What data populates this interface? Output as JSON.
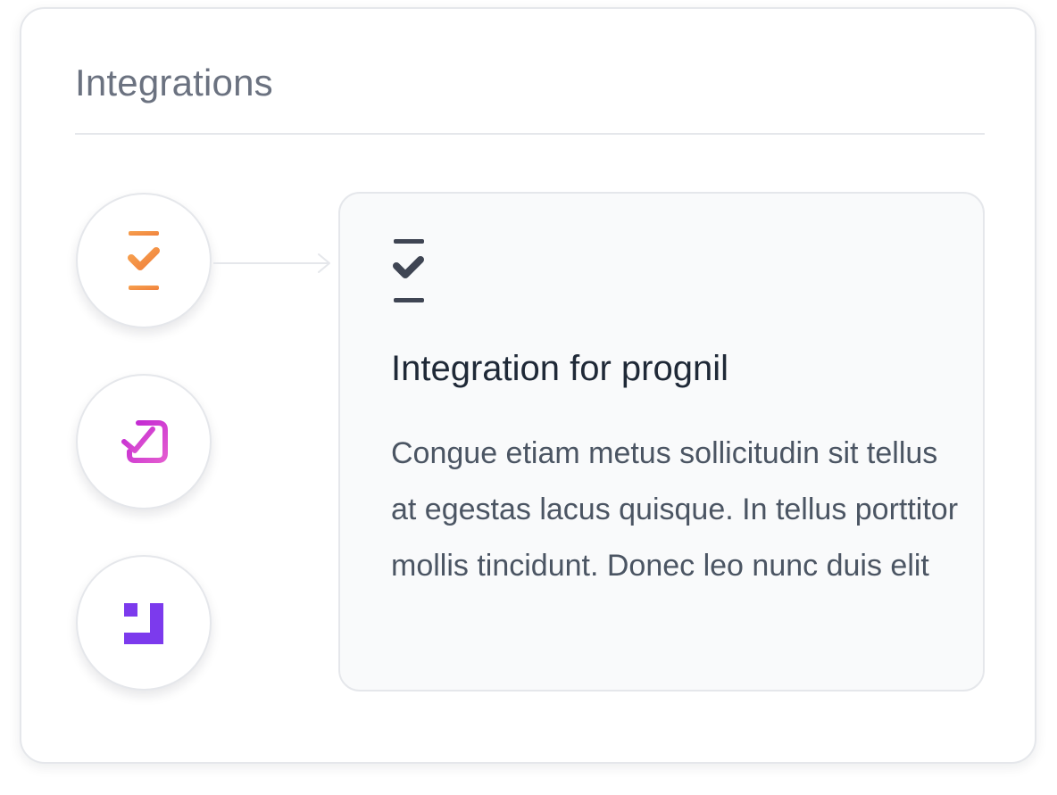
{
  "header": {
    "title": "Integrations"
  },
  "integrations": [
    {
      "icon": "orange-check-bracket-icon",
      "color": "#f5914a",
      "selected": true
    },
    {
      "icon": "magenta-check-square-icon",
      "color": "#d946c8",
      "selected": false
    },
    {
      "icon": "purple-corner-square-icon",
      "color": "#7c3aed",
      "selected": false
    }
  ],
  "detail": {
    "icon": "dark-check-bracket-icon",
    "icon_color": "#3f4553",
    "title": "Integration for prognil",
    "description": "Congue etiam metus sollicitudin sit tellus at egestas lacus quisque. In tellus porttitor mollis tincidunt. Donec leo nunc duis elit"
  },
  "colors": {
    "card_border": "#e5e7eb",
    "title_text": "#6b7280",
    "detail_bg": "#f9fafb",
    "heading_text": "#1f2937",
    "body_text": "#4b5563"
  }
}
